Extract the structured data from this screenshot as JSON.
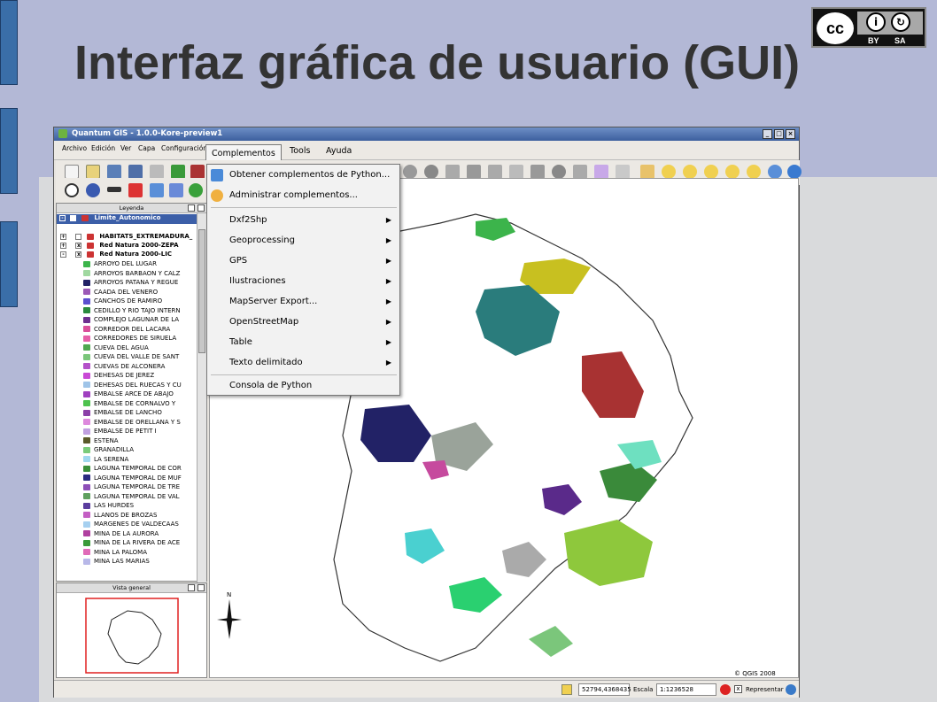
{
  "slide": {
    "title": "Interfaz gráfica de usuario (GUI)",
    "license": {
      "cc": "cc",
      "by": "BY",
      "sa": "SA"
    }
  },
  "window": {
    "title": "Quantum GIS - 1.0.0-Kore-preview1"
  },
  "menubar": {
    "items": [
      "Archivo",
      "Edición",
      "Ver",
      "Capa",
      "Configuración"
    ],
    "open_menu": "Complementos",
    "more": [
      "Tools",
      "Ayuda"
    ]
  },
  "dropdown": {
    "items": [
      {
        "label": "Obtener complementos de Python...",
        "submenu": false,
        "icon": "download-plugin-icon"
      },
      {
        "label": "Administrar complementos...",
        "submenu": false,
        "icon": "manage-plugins-icon"
      },
      {
        "label": "Dxf2Shp",
        "submenu": true
      },
      {
        "label": "Geoprocessing",
        "submenu": true
      },
      {
        "label": "GPS",
        "submenu": true
      },
      {
        "label": "Ilustraciones",
        "submenu": true
      },
      {
        "label": "MapServer Export...",
        "submenu": true
      },
      {
        "label": "OpenStreetMap",
        "submenu": true
      },
      {
        "label": "Table",
        "submenu": true
      },
      {
        "label": "Texto delimitado",
        "submenu": true
      },
      {
        "label": "Consola de Python",
        "submenu": false
      }
    ]
  },
  "legend": {
    "title": "Leyenda",
    "root_layer": "Limite_Autonomico",
    "groups": [
      "HABITATS_EXTREMADURA_",
      "Red Natura 2000-ZEPA",
      "Red Natura 2000-LIC"
    ],
    "items": [
      {
        "label": "ARROYO DEL LUGAR",
        "color": "#3cb44b"
      },
      {
        "label": "ARROYOS BARBAON Y CALZ",
        "color": "#a0d8a0"
      },
      {
        "label": "ARROYOS PATANA Y REGUE",
        "color": "#222266"
      },
      {
        "label": "CAADA DEL VENERO",
        "color": "#9b59b6"
      },
      {
        "label": "CANCHOS DE RAMIRO",
        "color": "#5b4fcf"
      },
      {
        "label": "CEDILLO Y RIO TAJO INTERN",
        "color": "#2b8a3e"
      },
      {
        "label": "COMPLEJO LAGUNAR DE LA",
        "color": "#6d2f8f"
      },
      {
        "label": "CORREDOR DEL LACARA",
        "color": "#d94f9a"
      },
      {
        "label": "CORREDORES DE SIRUELA",
        "color": "#e65fa8"
      },
      {
        "label": "CUEVA DEL AGUA",
        "color": "#4fa84f"
      },
      {
        "label": "CUEVA DEL VALLE DE SANT",
        "color": "#7bc67b"
      },
      {
        "label": "CUEVAS DE ALCONERA",
        "color": "#b452c9"
      },
      {
        "label": "DEHESAS DE JEREZ",
        "color": "#c94ad6"
      },
      {
        "label": "DEHESAS DEL RUECAS Y CU",
        "color": "#9fc4e8"
      },
      {
        "label": "EMBALSE ARCE DE ABAJO",
        "color": "#a040c0"
      },
      {
        "label": "EMBALSE DE CORNALVO Y",
        "color": "#4ec24e"
      },
      {
        "label": "EMBALSE DE LANCHO",
        "color": "#8b3fa8"
      },
      {
        "label": "EMBALSE DE ORELLANA Y S",
        "color": "#dd88dd"
      },
      {
        "label": "EMBALSE DE PETIT I",
        "color": "#c0a0e0"
      },
      {
        "label": "ESTENA",
        "color": "#5a5a2a"
      },
      {
        "label": "GRANADILLA",
        "color": "#7acb7a"
      },
      {
        "label": "LA SERENA",
        "color": "#9fd8ef"
      },
      {
        "label": "LAGUNA TEMPORAL DE COR",
        "color": "#3a8f3a"
      },
      {
        "label": "LAGUNA TEMPORAL DE MUF",
        "color": "#2a2a80"
      },
      {
        "label": "LAGUNA TEMPORAL DE TRE",
        "color": "#8d4fb8"
      },
      {
        "label": "LAGUNA TEMPORAL DE VAL",
        "color": "#5fa05f"
      },
      {
        "label": "LAS HURDES",
        "color": "#5b3d9e"
      },
      {
        "label": "LLANOS DE BROZAS",
        "color": "#c45fc4"
      },
      {
        "label": "MARGENES DE VALDECAAS",
        "color": "#a6d0f0"
      },
      {
        "label": "MINA DE LA AURORA",
        "color": "#b040a0"
      },
      {
        "label": "MINA DE LA RIVERA DE ACE",
        "color": "#3a9a3a"
      },
      {
        "label": "MINA LA PALOMA",
        "color": "#e06ab8"
      },
      {
        "label": "MINA LAS MARIAS",
        "color": "#b8b8e8"
      }
    ]
  },
  "overview": {
    "title": "Vista general"
  },
  "map": {
    "copyright": "© QGIS 2008",
    "north": "N"
  },
  "status": {
    "coords": "52794,4368435",
    "scale_label": "Escala",
    "scale_value": "1:1236528",
    "render_label": "Representar"
  },
  "colors": {
    "slide_bg": "#b3b8d6",
    "title": "#333333",
    "accent_bar": "#3a6ea8"
  }
}
